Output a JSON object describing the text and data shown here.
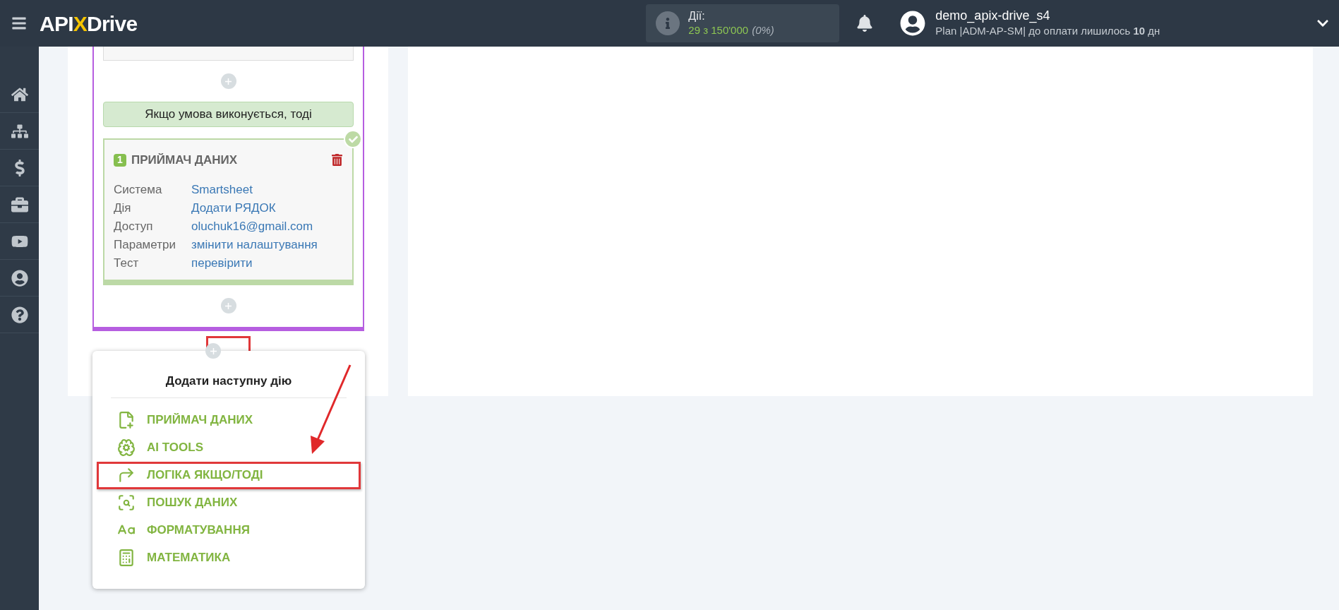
{
  "header": {
    "logo": {
      "left": "API",
      "mark": "X",
      "right": "Drive"
    },
    "actions": {
      "label": "Дії:",
      "count": "29 з 150'000",
      "percent": "(0%)"
    },
    "user": {
      "name": "demo_apix-drive_s4",
      "plan": "Plan |ADM-AP-SM| до оплати лишилось **10** дн"
    }
  },
  "flow": {
    "condition": "Якщо умова виконується, тоді",
    "card": {
      "number": "1",
      "title": "ПРИЙМАЧ ДАНИХ",
      "done": true,
      "rows": [
        {
          "label": "Система",
          "value": "Smartsheet"
        },
        {
          "label": "Дія",
          "value": "Додати РЯДОК"
        },
        {
          "label": "Доступ",
          "value": "oluchuk16@gmail.com"
        },
        {
          "label": "Параметри",
          "value": "змінити налаштування"
        },
        {
          "label": "Тест",
          "value": "перевірити"
        }
      ]
    }
  },
  "menu": {
    "title": "Додати наступну дію",
    "items": [
      {
        "label": "ПРИЙМАЧ ДАНИХ",
        "highlighted": false
      },
      {
        "label": "AI TOOLS",
        "highlighted": false
      },
      {
        "label": "ЛОГІКА ЯКЩО/ТОДІ",
        "highlighted": true
      },
      {
        "label": "ПОШУК ДАНИХ",
        "highlighted": false
      },
      {
        "label": "ФОРМАТУВАННЯ",
        "highlighted": false
      },
      {
        "label": "МАТЕМАТИКА",
        "highlighted": false
      }
    ]
  }
}
